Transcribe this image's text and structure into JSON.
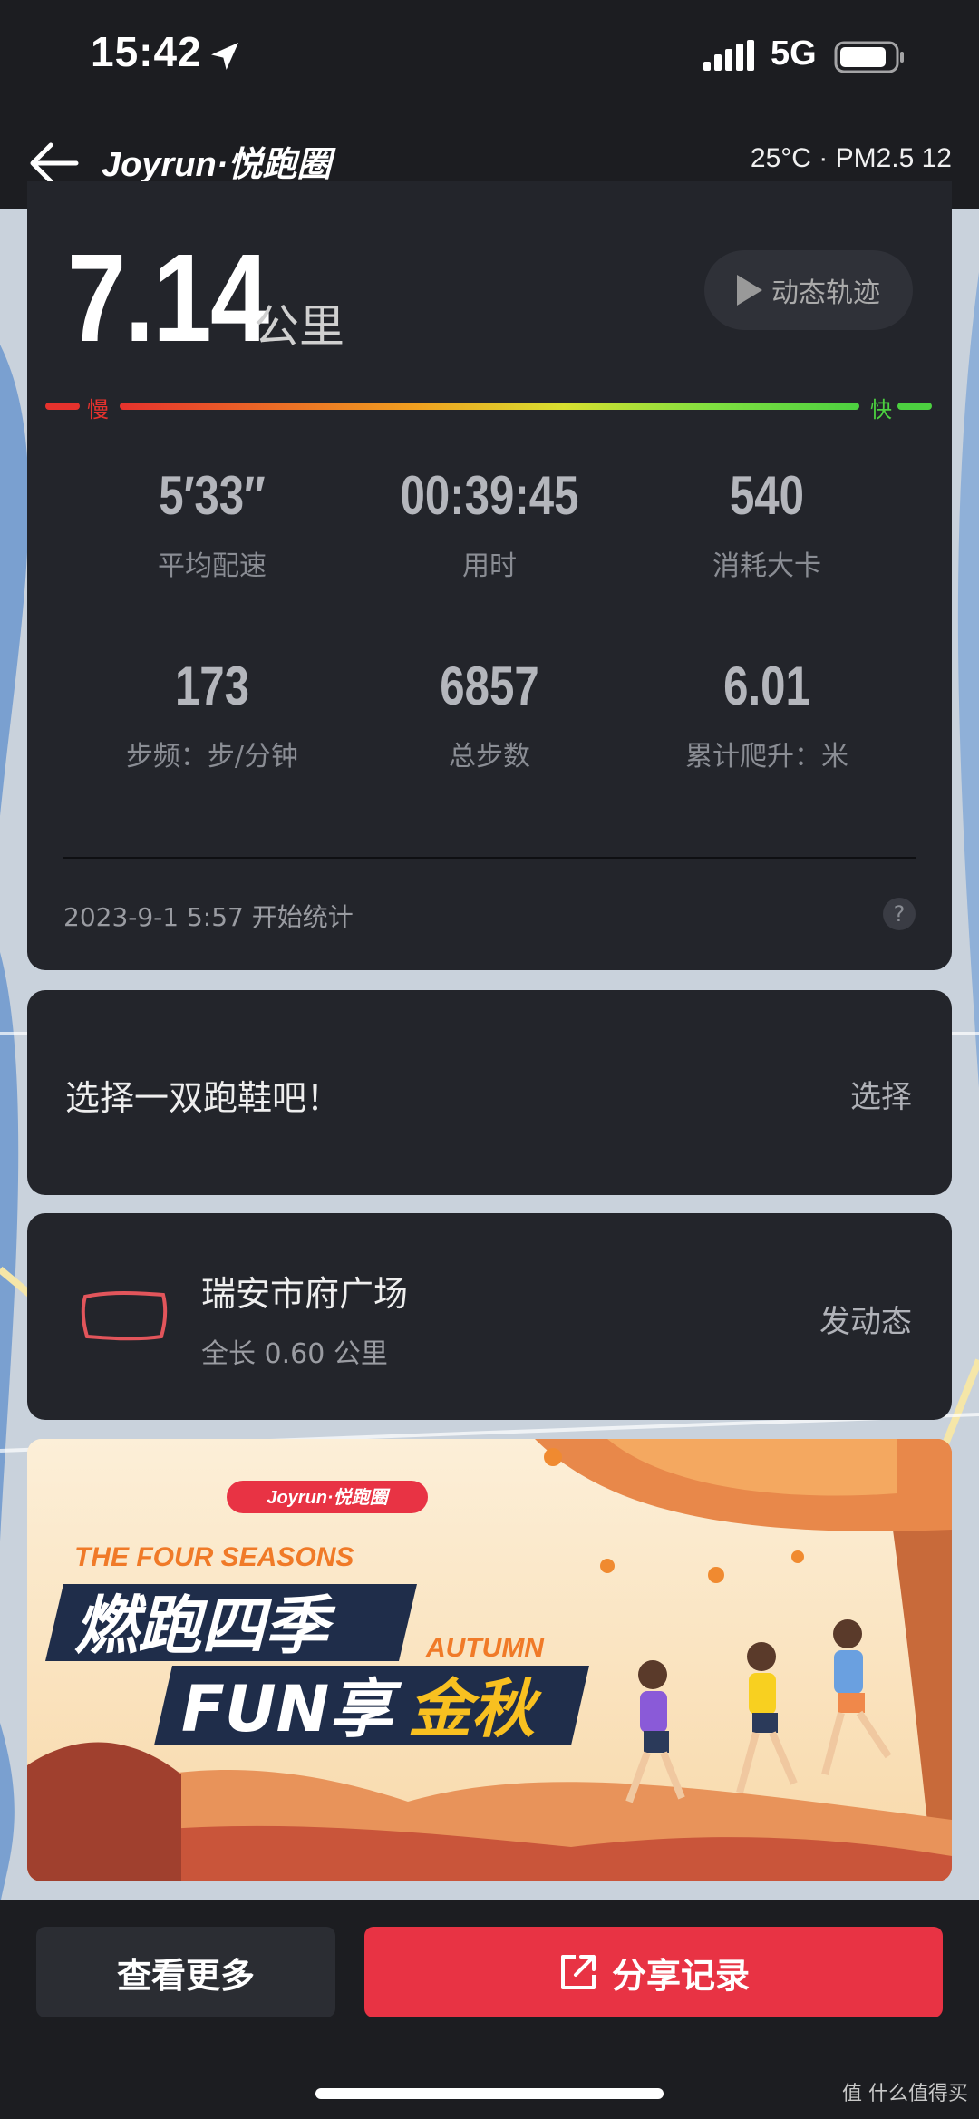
{
  "status_bar": {
    "time": "15:42",
    "network": "5G"
  },
  "header": {
    "app_logo": "Joyrun·悦跑圈",
    "weather": "25°C · PM2.5 12"
  },
  "run": {
    "distance": "7.14",
    "distance_unit": "公里",
    "track_button": "动态轨迹",
    "pace_slow": "慢",
    "pace_fast": "快",
    "stats": [
      {
        "value": "5′33″",
        "label": "平均配速"
      },
      {
        "value": "00:39:45",
        "label": "用时"
      },
      {
        "value": "540",
        "label": "消耗大卡"
      },
      {
        "value": "173",
        "label": "步频：步/分钟"
      },
      {
        "value": "6857",
        "label": "总步数"
      },
      {
        "value": "6.01",
        "label": "累计爬升：米"
      }
    ],
    "start_info": "2023-9-1 5:57 开始统计",
    "help_icon": "?"
  },
  "shoe": {
    "prompt": "选择一双跑鞋吧！",
    "select_label": "选择"
  },
  "route": {
    "name": "瑞安市府广场",
    "length": "全长 0.60 公里",
    "post_label": "发动态"
  },
  "banner": {
    "brand": "Joyrun·悦跑圈",
    "subtitle": "THE FOUR SEASONS",
    "line1": "燃跑四季",
    "line2a": "FUN享",
    "line2b": "金秋",
    "tag": "AUTUMN"
  },
  "bottom": {
    "more_label": "查看更多",
    "share_label": "分享记录",
    "watermark": "值 什么值得买"
  },
  "icons": {
    "back": "back-arrow-icon",
    "location": "location-arrow-icon",
    "signal": "signal-icon",
    "battery": "battery-icon",
    "play": "play-icon",
    "share": "share-icon",
    "route": "route-shape-icon"
  },
  "colors": {
    "accent": "#e83344",
    "card": "#23252b",
    "slow": "#e6322d",
    "fast": "#4cd040"
  }
}
